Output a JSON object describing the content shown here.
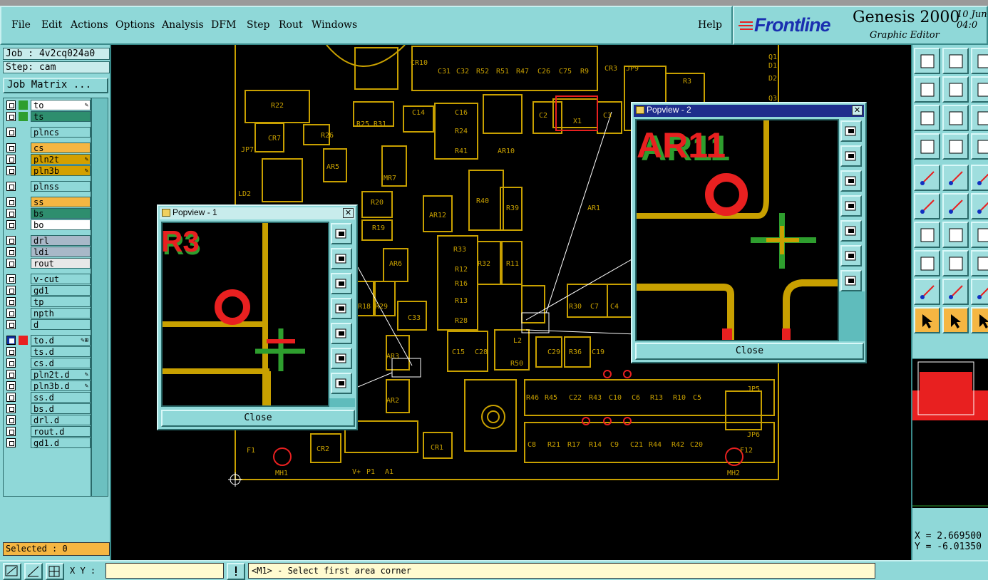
{
  "menu": {
    "items": [
      {
        "label": "File"
      },
      {
        "label": "Edit"
      },
      {
        "label": "Actions"
      },
      {
        "label": "Options"
      },
      {
        "label": "Analysis"
      },
      {
        "label": "DFM"
      },
      {
        "label": "Step"
      },
      {
        "label": "Rout"
      },
      {
        "label": "Windows"
      }
    ],
    "help": "Help"
  },
  "brand": {
    "logo": "Frontline",
    "product": "Genesis 2000",
    "subtitle": "Graphic Editor",
    "date_line1": "10 Jun",
    "date_line2": "04:0"
  },
  "job": {
    "job_label": "Job : 4v2cq024a0",
    "step_label": "Step: cam",
    "matrix_button": "Job Matrix ..."
  },
  "layers": [
    {
      "name": "to",
      "color": "#2e9e2e",
      "bg": "#ffffff",
      "active": false,
      "mark": "✎"
    },
    {
      "name": "ts",
      "color": "#2e9e2e",
      "bg": "#2e8e6e",
      "active": false,
      "mark": ""
    },
    {
      "name": "plncs",
      "color": "",
      "bg": "#8fd8d8",
      "active": false,
      "mark": ""
    },
    {
      "name": "cs",
      "color": "",
      "bg": "#f5b642",
      "active": false,
      "mark": ""
    },
    {
      "name": "pln2t",
      "color": "",
      "bg": "#d4a000",
      "active": false,
      "mark": "✎"
    },
    {
      "name": "pln3b",
      "color": "",
      "bg": "#d4a000",
      "active": false,
      "mark": "✎"
    },
    {
      "name": "plnss",
      "color": "",
      "bg": "#8fd8d8",
      "active": false,
      "mark": ""
    },
    {
      "name": "ss",
      "color": "",
      "bg": "#f5b642",
      "active": false,
      "mark": ""
    },
    {
      "name": "bs",
      "color": "",
      "bg": "#2e8e6e",
      "active": false,
      "mark": ""
    },
    {
      "name": "bo",
      "color": "",
      "bg": "#ffffff",
      "active": false,
      "mark": ""
    },
    {
      "name": "drl",
      "color": "",
      "bg": "#a8b8c8",
      "active": false,
      "mark": ""
    },
    {
      "name": "ldi",
      "color": "",
      "bg": "#a8b8c8",
      "active": false,
      "mark": ""
    },
    {
      "name": "rout",
      "color": "",
      "bg": "#e8e8e8",
      "active": false,
      "mark": ""
    },
    {
      "name": "v-cut",
      "color": "",
      "bg": "#8fd8d8",
      "active": false,
      "mark": ""
    },
    {
      "name": "gd1",
      "color": "",
      "bg": "#8fd8d8",
      "active": false,
      "mark": ""
    },
    {
      "name": "tp",
      "color": "",
      "bg": "#8fd8d8",
      "active": false,
      "mark": ""
    },
    {
      "name": "npth",
      "color": "",
      "bg": "#8fd8d8",
      "active": false,
      "mark": ""
    },
    {
      "name": "d",
      "color": "",
      "bg": "#8fd8d8",
      "active": false,
      "mark": ""
    },
    {
      "name": "to.d",
      "color": "#e82020",
      "bg": "#8fd8d8",
      "active": true,
      "mark": "✎⊞"
    },
    {
      "name": "ts.d",
      "color": "",
      "bg": "#8fd8d8",
      "active": false,
      "mark": ""
    },
    {
      "name": "cs.d",
      "color": "",
      "bg": "#8fd8d8",
      "active": false,
      "mark": ""
    },
    {
      "name": "pln2t.d",
      "color": "",
      "bg": "#8fd8d8",
      "active": false,
      "mark": "✎"
    },
    {
      "name": "pln3b.d",
      "color": "",
      "bg": "#8fd8d8",
      "active": false,
      "mark": "✎"
    },
    {
      "name": "ss.d",
      "color": "",
      "bg": "#8fd8d8",
      "active": false,
      "mark": ""
    },
    {
      "name": "bs.d",
      "color": "",
      "bg": "#8fd8d8",
      "active": false,
      "mark": ""
    },
    {
      "name": "drl.d",
      "color": "",
      "bg": "#8fd8d8",
      "active": false,
      "mark": ""
    },
    {
      "name": "rout.d",
      "color": "",
      "bg": "#8fd8d8",
      "active": false,
      "mark": ""
    },
    {
      "name": "gd1.d",
      "color": "",
      "bg": "#8fd8d8",
      "active": false,
      "mark": ""
    }
  ],
  "selected": "Selected : 0",
  "coords": {
    "x": "X = 2.669500",
    "y": "Y = -6.01350"
  },
  "status": {
    "xy_label": "X Y :",
    "xy_value": "",
    "message": "<M1> - Select first area corner"
  },
  "popview1": {
    "title": "Popview - 1",
    "close": "Close",
    "label": "R3"
  },
  "popview2": {
    "title": "Popview - 2",
    "close": "Close",
    "label": "AR11"
  },
  "board_labels": [
    "R22",
    "CR7",
    "R26",
    "AR5",
    "R25",
    "R31",
    "C14",
    "C16",
    "R24",
    "R41",
    "C2",
    "X1",
    "C3",
    "R3",
    "CR10",
    "C31",
    "C32",
    "R52",
    "R51",
    "R47",
    "C26",
    "C75",
    "R9",
    "CR3",
    "JP9",
    "AR10",
    "MR7",
    "R20",
    "R19",
    "AR12",
    "R40",
    "R39",
    "AR1",
    "AR6",
    "R33",
    "R12",
    "R32",
    "R11",
    "R16",
    "R13",
    "R28",
    "R18",
    "R29",
    "C33",
    "AR3",
    "AR2",
    "C15",
    "C28",
    "L2",
    "R50",
    "C29",
    "R36",
    "C19",
    "R30",
    "C7",
    "C4",
    "R46",
    "R45",
    "C22",
    "R43",
    "C10",
    "C6",
    "R13",
    "R10",
    "C5",
    "C8",
    "R21",
    "R17",
    "R14",
    "C9",
    "C21",
    "R44",
    "R42",
    "C20",
    "CR2",
    "CR1",
    "F1",
    "F12",
    "MH1",
    "MH2",
    "JP5",
    "JP6",
    "P1",
    "A1",
    "V+",
    "LD2",
    "JP7",
    "Q1",
    "D2",
    "Q3",
    "D1"
  ]
}
